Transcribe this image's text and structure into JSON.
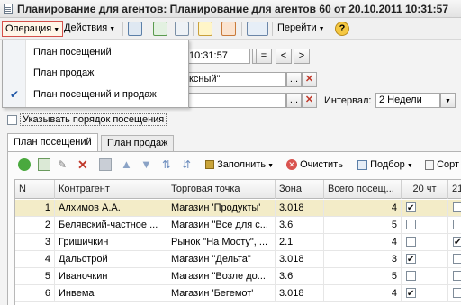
{
  "window": {
    "title": "Планирование для агентов: Планирование для агентов 60 от 20.10.2011 10:31:57"
  },
  "toolbar": {
    "operation_label": "Операция",
    "actions_label": "Действия",
    "goto_label": "Перейти",
    "help_label": "?"
  },
  "operation_menu": {
    "items": [
      {
        "label": "План посещений",
        "checked": false
      },
      {
        "label": "План продаж",
        "checked": false
      },
      {
        "label": "План посещений и продаж",
        "checked": true
      }
    ]
  },
  "header_form": {
    "date_value": "10:31:57",
    "eq_button": "=",
    "prev_button": "<",
    "next_button": ">",
    "field2_value": "ксный\"",
    "more_button": "...",
    "clear_button": "✕",
    "interval_label": "Интервал:",
    "interval_value": "2 Недели",
    "order_checkbox_label": "Указывать порядок посещения"
  },
  "tabs": [
    {
      "label": "План посещений",
      "active": true
    },
    {
      "label": "План продаж",
      "active": false
    }
  ],
  "grid_toolbar": {
    "fill_label": "Заполнить",
    "clear_label": "Очистить",
    "pick_label": "Подбор",
    "sort_label": "Сорт"
  },
  "grid": {
    "columns": [
      "N",
      "Контрагент",
      "Торговая точка",
      "Зона",
      "Всего посещ...",
      "20 чт",
      "21"
    ],
    "rows": [
      {
        "n": "1",
        "contractor": "Алхимов А.А.",
        "point": "Магазин 'Продукты'",
        "zone": "3.018",
        "total": "4",
        "c20": true,
        "c21": false,
        "selected": true
      },
      {
        "n": "2",
        "contractor": "Белявский-частное ...",
        "point": "Магазин \"Все для с...",
        "zone": "3.6",
        "total": "5",
        "c20": false,
        "c21": false,
        "selected": false
      },
      {
        "n": "3",
        "contractor": "Гришичкин",
        "point": "Рынок \"На Мосту\", ...",
        "zone": "2.1",
        "total": "4",
        "c20": false,
        "c21": true,
        "selected": false
      },
      {
        "n": "4",
        "contractor": "Дальстрой",
        "point": "Магазин \"Дельта\"",
        "zone": "3.018",
        "total": "3",
        "c20": true,
        "c21": false,
        "selected": false
      },
      {
        "n": "5",
        "contractor": "Иваночкин",
        "point": "Магазин \"Возле до...",
        "zone": "3.6",
        "total": "5",
        "c20": false,
        "c21": false,
        "selected": false
      },
      {
        "n": "6",
        "contractor": "Инвема",
        "point": "Магазин 'Бегемот'",
        "zone": "3.018",
        "total": "4",
        "c20": true,
        "c21": false,
        "selected": false
      }
    ]
  }
}
